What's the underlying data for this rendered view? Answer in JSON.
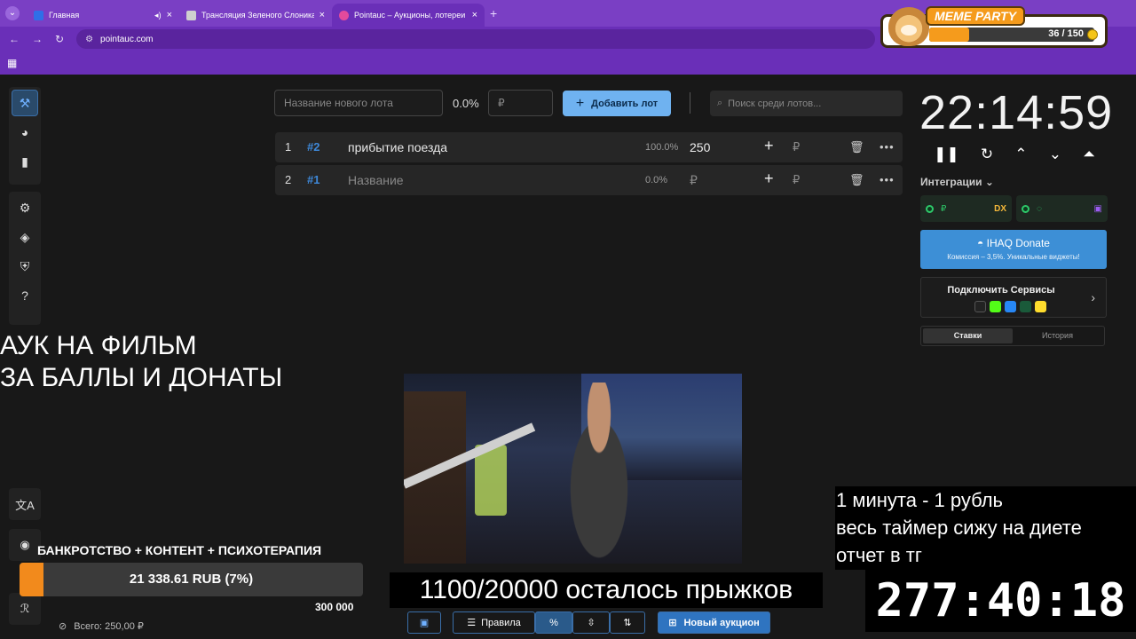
{
  "browser": {
    "tabs": [
      {
        "title": "Главная",
        "favicon_color": "#2f6fe8",
        "audio": true
      },
      {
        "title": "Трансляция Зеленого Слоника",
        "favicon_color": "#cfcfcf",
        "audio": false
      },
      {
        "title": "Pointauc – Аукционы, лотереи",
        "favicon_color": "#e24a9c",
        "audio": false
      }
    ],
    "url": "pointauc.com"
  },
  "meme_party": {
    "title": "MEME PARTY",
    "progress": "36 / 150",
    "progress_value": 36,
    "progress_max": 150
  },
  "lot_input": {
    "name_placeholder": "Название нового лота",
    "percent": "0.0%",
    "amount_placeholder": "₽",
    "add_label": "Добавить лот",
    "search_placeholder": "Поиск среди лотов..."
  },
  "lots": [
    {
      "index": "1",
      "id": "#2",
      "name": "прибытие поезда",
      "percent": "100.0%",
      "amount": "250",
      "placeholder": false
    },
    {
      "index": "2",
      "id": "#1",
      "name": "Название",
      "percent": "0.0%",
      "amount": "₽",
      "placeholder": true
    }
  ],
  "timer": {
    "value": "22:14:59"
  },
  "integrations": {
    "label": "Интеграции",
    "donate_title": "IHAQ Donate",
    "donate_subtitle": "Комиссия – 3,5%. Уникальные виджеты!",
    "connect_label": "Подключить Сервисы",
    "tabs": [
      "Ставки",
      "История"
    ]
  },
  "overlays": {
    "auction_line1": "АУК НА ФИЛЬМ",
    "auction_line2": "ЗА БАЛЛЫ И ДОНАТЫ",
    "jumps": "1100/20000 осталось прыжков",
    "diet_line1": "1 минута - 1 рубль",
    "diet_line2": "весь таймер сижу на диете",
    "diet_line3": "отчет в тг",
    "big_timer": "277:40:18"
  },
  "bank": {
    "title": "БАНКРОТСТВО + КОНТЕНТ + ПСИХОТЕРАПИЯ",
    "progress_label": "21 338.61 RUB (7%)",
    "progress_percent": 7,
    "goal": "300 000",
    "total": "Всего: 250,00 ₽"
  },
  "toolbar": {
    "rules": "Правила",
    "new_auction": "Новый аукцион"
  },
  "colors": {
    "accent": "#6fb2f0",
    "browser": "#7a3fc4",
    "orange": "#f28a1c"
  }
}
